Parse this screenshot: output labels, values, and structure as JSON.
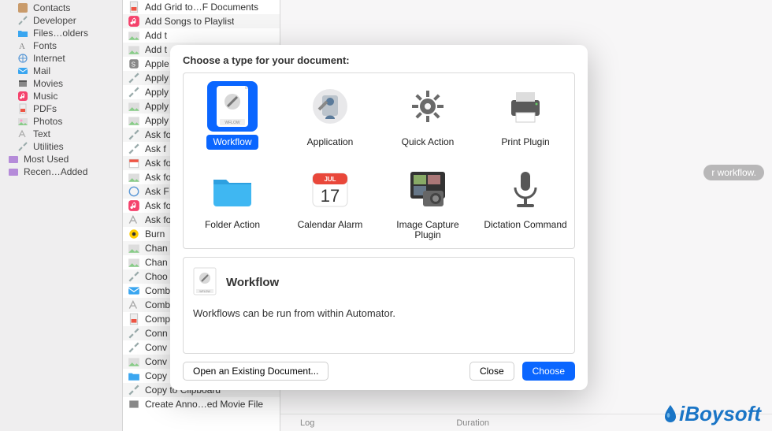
{
  "sidebar": {
    "items": [
      {
        "label": "Contacts",
        "icon": "contacts"
      },
      {
        "label": "Developer",
        "icon": "tools"
      },
      {
        "label": "Files…olders",
        "icon": "files"
      },
      {
        "label": "Fonts",
        "icon": "font"
      },
      {
        "label": "Internet",
        "icon": "globe"
      },
      {
        "label": "Mail",
        "icon": "mail"
      },
      {
        "label": "Movies",
        "icon": "movie"
      },
      {
        "label": "Music",
        "icon": "music"
      },
      {
        "label": "PDFs",
        "icon": "pdf"
      },
      {
        "label": "Photos",
        "icon": "photo"
      },
      {
        "label": "Text",
        "icon": "text"
      },
      {
        "label": "Utilities",
        "icon": "tools"
      }
    ],
    "groups": [
      {
        "label": "Most Used"
      },
      {
        "label": "Recen…Added"
      }
    ]
  },
  "actions": [
    {
      "label": "Add Grid to…F Documents",
      "icon": "pdf"
    },
    {
      "label": "Add Songs to Playlist",
      "icon": "music"
    },
    {
      "label": "Add t",
      "icon": "photo"
    },
    {
      "label": "Add t",
      "icon": "photo"
    },
    {
      "label": "Apple",
      "icon": "script"
    },
    {
      "label": "Apply",
      "icon": "tools"
    },
    {
      "label": "Apply",
      "icon": "tools"
    },
    {
      "label": "Apply",
      "icon": "photo"
    },
    {
      "label": "Apply",
      "icon": "photo"
    },
    {
      "label": "Ask fo",
      "icon": "tools"
    },
    {
      "label": "Ask f",
      "icon": "tools"
    },
    {
      "label": "Ask fo",
      "icon": "calendar"
    },
    {
      "label": "Ask fo",
      "icon": "photo"
    },
    {
      "label": "Ask F",
      "icon": "globe"
    },
    {
      "label": "Ask fo",
      "icon": "music"
    },
    {
      "label": "Ask fo",
      "icon": "text"
    },
    {
      "label": "Burn",
      "icon": "burn"
    },
    {
      "label": "Chan",
      "icon": "photo"
    },
    {
      "label": "Chan",
      "icon": "photo"
    },
    {
      "label": "Choo",
      "icon": "tools"
    },
    {
      "label": "Comb",
      "icon": "mail"
    },
    {
      "label": "Comb",
      "icon": "text"
    },
    {
      "label": "Comp",
      "icon": "pdf"
    },
    {
      "label": "Conn",
      "icon": "tools"
    },
    {
      "label": "Conv",
      "icon": "tools"
    },
    {
      "label": "Conv",
      "icon": "photo"
    },
    {
      "label": "Copy",
      "icon": "files"
    },
    {
      "label": "Copy to Clipboard",
      "icon": "tools"
    },
    {
      "label": "Create Anno…ed Movie File",
      "icon": "movie"
    }
  ],
  "rightpane": {
    "hint_tail": "r workflow.",
    "tabs": [
      "Log",
      "Duration"
    ]
  },
  "dialog": {
    "title": "Choose a type for your document:",
    "types": [
      {
        "label": "Workflow",
        "selected": true
      },
      {
        "label": "Application"
      },
      {
        "label": "Quick Action"
      },
      {
        "label": "Print Plugin"
      },
      {
        "label": "Folder Action"
      },
      {
        "label": "Calendar Alarm"
      },
      {
        "label": "Image Capture Plugin"
      },
      {
        "label": "Dictation Command"
      }
    ],
    "desc_title": "Workflow",
    "desc_body": "Workflows can be run from within Automator.",
    "open_label": "Open an Existing Document...",
    "close_label": "Close",
    "choose_label": "Choose",
    "calendar_month": "JUL",
    "calendar_day": "17"
  },
  "watermark": "iBoysoft"
}
